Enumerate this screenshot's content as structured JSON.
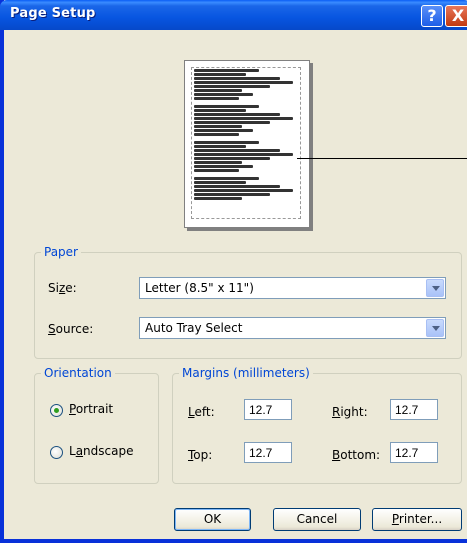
{
  "window": {
    "title": "Page Setup",
    "help_label": "?",
    "close_label": "X"
  },
  "paper": {
    "legend": "Paper",
    "size_label_pre": "Si",
    "size_label_u": "z",
    "size_label_post": "e:",
    "size_value": "Letter (8.5\" x 11\")",
    "source_label_u": "S",
    "source_label_post": "ource:",
    "source_value": "Auto Tray Select"
  },
  "orientation": {
    "legend": "Orientation",
    "portrait_label_u": "P",
    "portrait_label_post": "ortrait",
    "portrait_checked": true,
    "landscape_label_pre": "L",
    "landscape_label_u": "a",
    "landscape_label_post": "ndscape",
    "landscape_checked": false
  },
  "margins": {
    "legend": "Margins (millimeters)",
    "left_u": "L",
    "left_post": "eft:",
    "left_value": "12.7",
    "right_u": "R",
    "right_post": "ight:",
    "right_value": "12.7",
    "top_u": "T",
    "top_post": "op:",
    "top_value": "12.7",
    "bottom_u": "B",
    "bottom_post": "ottom:",
    "bottom_value": "12.7"
  },
  "buttons": {
    "ok_label": "OK",
    "cancel_label": "Cancel",
    "printer_u": "P",
    "printer_post": "rinter..."
  }
}
